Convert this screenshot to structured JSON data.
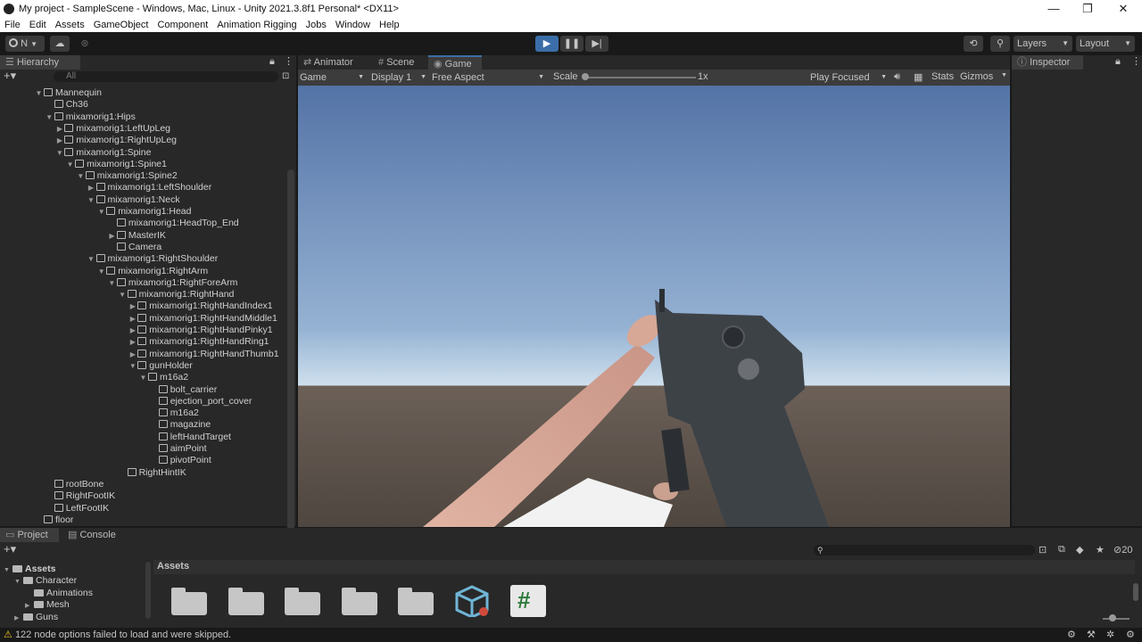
{
  "window": {
    "title": "My project - SampleScene - Windows, Mac, Linux - Unity 2021.3.8f1 Personal* <DX11>",
    "minimize": "—",
    "maximize": "❐",
    "close": "✕"
  },
  "menu": [
    "File",
    "Edit",
    "Assets",
    "GameObject",
    "Component",
    "Animation Rigging",
    "Jobs",
    "Window",
    "Help"
  ],
  "toolbar": {
    "account_label": "N",
    "layers_label": "Layers",
    "layout_label": "Layout"
  },
  "hierarchy": {
    "tab": "Hierarchy",
    "search_placeholder": "All",
    "rows": [
      {
        "label": "Mannequin",
        "depth": 0,
        "arrow": "▼"
      },
      {
        "label": "Ch36",
        "depth": 1,
        "arrow": ""
      },
      {
        "label": "mixamorig1:Hips",
        "depth": 1,
        "arrow": "▼"
      },
      {
        "label": "mixamorig1:LeftUpLeg",
        "depth": 2,
        "arrow": "▶"
      },
      {
        "label": "mixamorig1:RightUpLeg",
        "depth": 2,
        "arrow": "▶"
      },
      {
        "label": "mixamorig1:Spine",
        "depth": 2,
        "arrow": "▼"
      },
      {
        "label": "mixamorig1:Spine1",
        "depth": 3,
        "arrow": "▼"
      },
      {
        "label": "mixamorig1:Spine2",
        "depth": 4,
        "arrow": "▼"
      },
      {
        "label": "mixamorig1:LeftShoulder",
        "depth": 5,
        "arrow": "▶"
      },
      {
        "label": "mixamorig1:Neck",
        "depth": 5,
        "arrow": "▼"
      },
      {
        "label": "mixamorig1:Head",
        "depth": 6,
        "arrow": "▼"
      },
      {
        "label": "mixamorig1:HeadTop_End",
        "depth": 7,
        "arrow": ""
      },
      {
        "label": "MasterIK",
        "depth": 7,
        "arrow": "▶"
      },
      {
        "label": "Camera",
        "depth": 7,
        "arrow": ""
      },
      {
        "label": "mixamorig1:RightShoulder",
        "depth": 5,
        "arrow": "▼"
      },
      {
        "label": "mixamorig1:RightArm",
        "depth": 6,
        "arrow": "▼"
      },
      {
        "label": "mixamorig1:RightForeArm",
        "depth": 7,
        "arrow": "▼"
      },
      {
        "label": "mixamorig1:RightHand",
        "depth": 8,
        "arrow": "▼"
      },
      {
        "label": "mixamorig1:RightHandIndex1",
        "depth": 9,
        "arrow": "▶"
      },
      {
        "label": "mixamorig1:RightHandMiddle1",
        "depth": 9,
        "arrow": "▶"
      },
      {
        "label": "mixamorig1:RightHandPinky1",
        "depth": 9,
        "arrow": "▶"
      },
      {
        "label": "mixamorig1:RightHandRing1",
        "depth": 9,
        "arrow": "▶"
      },
      {
        "label": "mixamorig1:RightHandThumb1",
        "depth": 9,
        "arrow": "▶"
      },
      {
        "label": "gunHolder",
        "depth": 9,
        "arrow": "▼"
      },
      {
        "label": "m16a2",
        "depth": 10,
        "arrow": "▼"
      },
      {
        "label": "bolt_carrier",
        "depth": 11,
        "arrow": ""
      },
      {
        "label": "ejection_port_cover",
        "depth": 11,
        "arrow": ""
      },
      {
        "label": "m16a2",
        "depth": 11,
        "arrow": ""
      },
      {
        "label": "magazine",
        "depth": 11,
        "arrow": ""
      },
      {
        "label": "leftHandTarget",
        "depth": 11,
        "arrow": ""
      },
      {
        "label": "aimPoint",
        "depth": 11,
        "arrow": ""
      },
      {
        "label": "pivotPoint",
        "depth": 11,
        "arrow": ""
      },
      {
        "label": "RightHintIK",
        "depth": 8,
        "arrow": ""
      },
      {
        "label": "rootBone",
        "depth": 1,
        "arrow": ""
      },
      {
        "label": "RightFootIK",
        "depth": 1,
        "arrow": ""
      },
      {
        "label": "LeftFootIK",
        "depth": 1,
        "arrow": ""
      },
      {
        "label": "floor",
        "depth": 0,
        "arrow": ""
      }
    ]
  },
  "center_tabs": [
    {
      "label": "Animator"
    },
    {
      "label": "Scene"
    },
    {
      "label": "Game"
    }
  ],
  "game_bar": {
    "mode": "Game",
    "display": "Display 1",
    "aspect": "Free Aspect",
    "scale_label": "Scale",
    "scale_value": "1x",
    "play_focused": "Play Focused",
    "stats": "Stats",
    "gizmos": "Gizmos"
  },
  "inspector": {
    "tab": "Inspector"
  },
  "project": {
    "tabs": [
      "Project",
      "Console"
    ],
    "breadcrumb": "Assets",
    "tree": [
      {
        "label": "Assets",
        "depth": 0,
        "arrow": "▼"
      },
      {
        "label": "Character",
        "depth": 1,
        "arrow": "▼"
      },
      {
        "label": "Animations",
        "depth": 2,
        "arrow": ""
      },
      {
        "label": "Mesh",
        "depth": 2,
        "arrow": "▶"
      },
      {
        "label": "Guns",
        "depth": 1,
        "arrow": "▶"
      }
    ],
    "hidden_count": "20"
  },
  "status": {
    "message": "122 node options failed to load and were skipped."
  },
  "colors": {
    "accent": "#3b6ea8",
    "sky_top": "#5a78a8",
    "sky_horizon": "#c7d9ea",
    "ground": "#5b5048",
    "warning": "#f0c020"
  }
}
